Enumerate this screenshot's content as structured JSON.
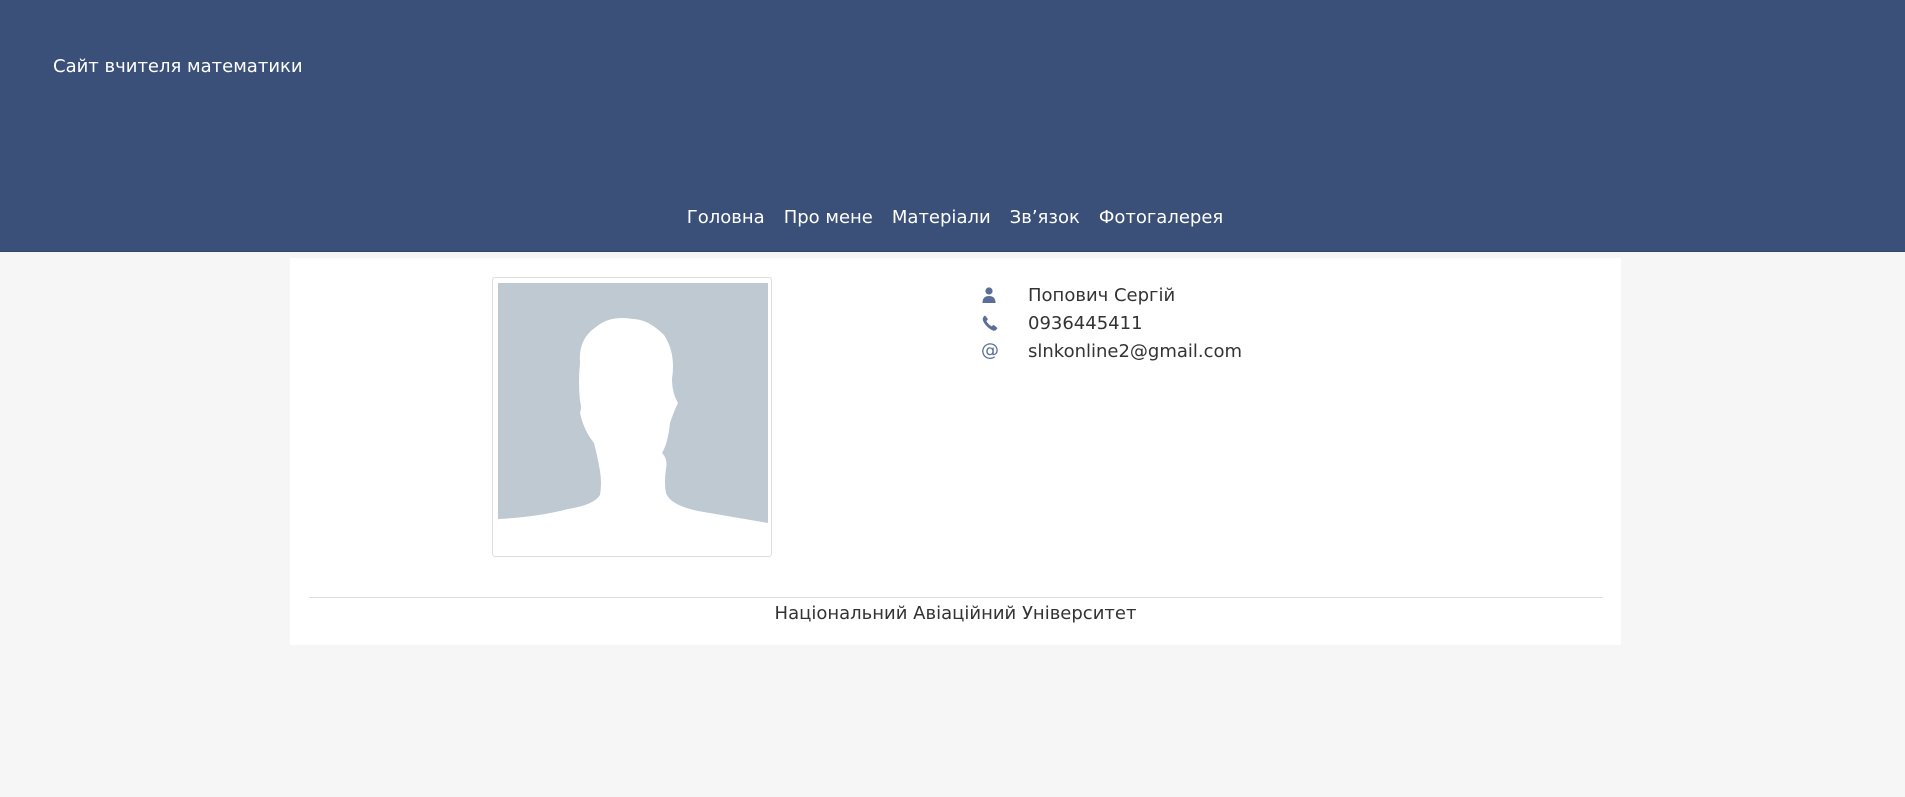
{
  "site": {
    "title": "Сайт вчителя математики"
  },
  "nav": {
    "items": [
      {
        "label": "Головна"
      },
      {
        "label": "Про мене"
      },
      {
        "label": "Матеріали"
      },
      {
        "label": "Зв’язок"
      },
      {
        "label": "Фотогалерея"
      }
    ]
  },
  "profile": {
    "photo_icon": "avatar-placeholder-silhouette",
    "name_icon": "user-icon",
    "name": "Попович Сергій",
    "phone_icon": "phone-icon",
    "phone": "0936445411",
    "email_icon_glyph": "@",
    "email": "slnkonline2@gmail.com"
  },
  "footer": {
    "university": "Національний Авіаційний Університет"
  },
  "colors": {
    "header_bg": "#3b5078",
    "page_bg": "#f6f6f6",
    "card_bg": "#ffffff",
    "icon": "#5a6e96",
    "avatar_bg": "#bfc9d2"
  }
}
